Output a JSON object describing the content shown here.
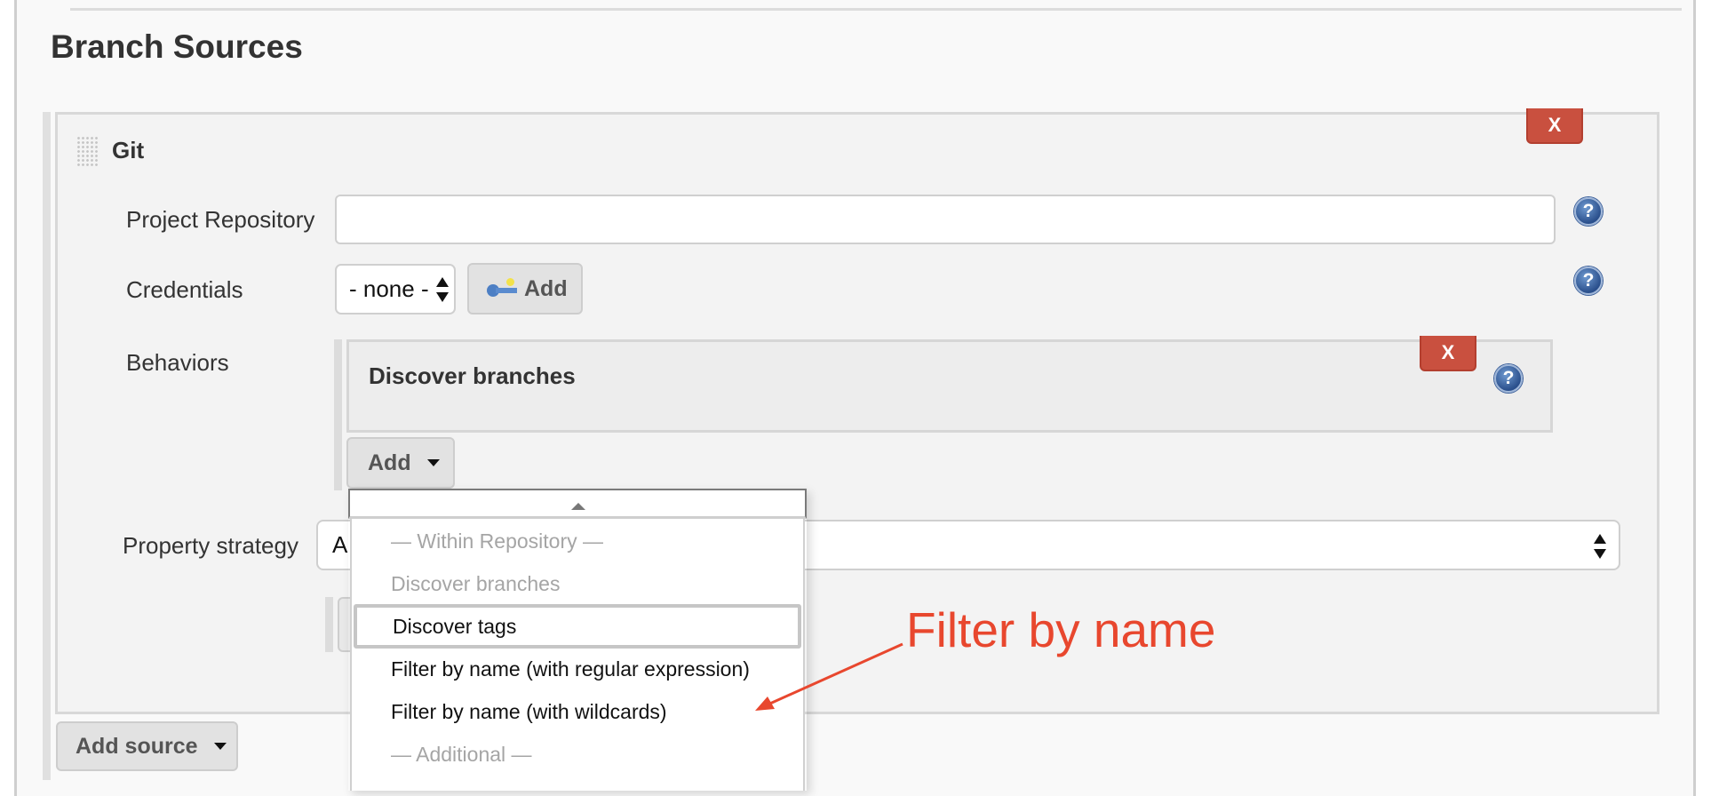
{
  "section": {
    "title": "Branch Sources"
  },
  "git_source": {
    "title": "Git",
    "delete_label": "X",
    "fields": {
      "project_repository": {
        "label": "Project Repository",
        "value": "",
        "placeholder": ""
      },
      "credentials": {
        "label": "Credentials",
        "selected": "- none -",
        "add_label": "Add"
      },
      "behaviors": {
        "label": "Behaviors",
        "items": [
          {
            "title": "Discover branches",
            "delete_label": "X"
          }
        ],
        "add_label": "Add"
      },
      "property_strategy": {
        "label": "Property strategy",
        "selected_visible": "A"
      }
    }
  },
  "add_source_label": "Add source",
  "help_glyph": "?",
  "behaviors_dropdown": {
    "items": [
      {
        "label": "— Within Repository —",
        "type": "header"
      },
      {
        "label": "Discover branches",
        "type": "disabled"
      },
      {
        "label": "Discover tags",
        "type": "focused"
      },
      {
        "label": "Filter by name (with regular expression)",
        "type": "option"
      },
      {
        "label": "Filter by name (with wildcards)",
        "type": "option"
      },
      {
        "label": "— Additional —",
        "type": "header"
      }
    ]
  },
  "annotation": {
    "text": "Filter by name",
    "color": "#e8472e"
  },
  "colors": {
    "delete_button": "#c9503f",
    "help_icon": "#2a4f8c"
  }
}
